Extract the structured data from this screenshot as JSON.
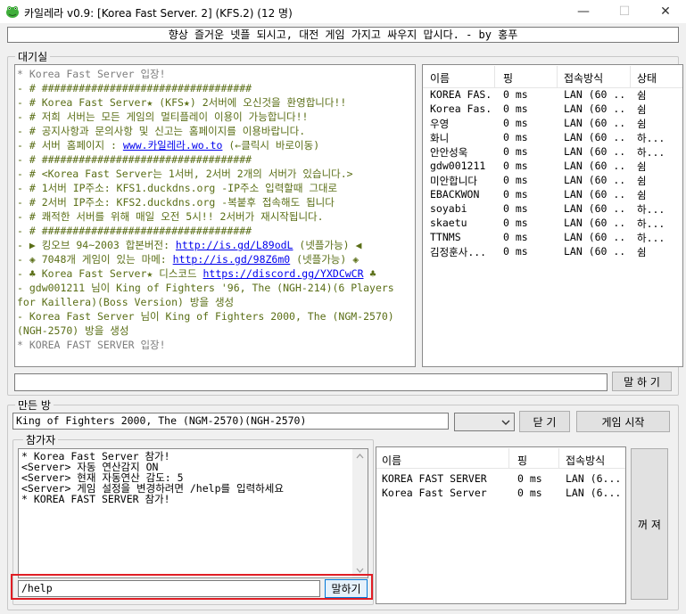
{
  "window": {
    "title": "카일레라 v0.9: [Korea Fast Server. 2] (KFS.2) (12 명)",
    "minimize_glyph": "—",
    "maximize_glyph": "☐",
    "close_glyph": "✕"
  },
  "banner": "향상 즐거운 넷플 되시고, 대전 게임 가지고 싸우지 맙시다. - by 홍푸",
  "lobby": {
    "label": "대기실",
    "chat": [
      {
        "text": "* Korea Fast Server 입장!",
        "kind": "gray"
      },
      {
        "text": "- # ##################################",
        "kind": "green"
      },
      {
        "text": "- # Korea Fast Server★ (KFS★) 2서버에 오신것을 환영합니다!!",
        "kind": "green"
      },
      {
        "text": "- # 저희 서버는 모든 게임의 멀티플레이 이용이 가능합니다!!",
        "kind": "green"
      },
      {
        "text": "- # 공지사항과 문의사항 및 신고는 홈페이지를 이용바랍니다.",
        "kind": "green"
      },
      {
        "pre": "- # 서버 홈페이지 : ",
        "link": "www.카일레라.wo.to",
        "post": " (←클릭시 바로이동)",
        "kind": "green"
      },
      {
        "text": "- # ##################################",
        "kind": "green"
      },
      {
        "text": "- # <Korea Fast Server는 1서버, 2서버 2개의 서버가 있습니다.>",
        "kind": "green"
      },
      {
        "text": "- # 1서버 IP주소: KFS1.duckdns.org -IP주소 입력할때 그대로",
        "kind": "green"
      },
      {
        "text": "- # 2서버 IP주소: KFS2.duckdns.org -복붙후 접속해도 됩니다",
        "kind": "green"
      },
      {
        "text": "- # 쾌적한 서버를 위해 매일 오전 5시!! 2서버가 재시작됩니다.",
        "kind": "green"
      },
      {
        "text": "- # ##################################",
        "kind": "green"
      },
      {
        "pre": "- ▶ 킹오브 94~2003 합본버전: ",
        "link": "http://is.gd/L89odL",
        "post": " (넷플가능) ◀",
        "kind": "green"
      },
      {
        "pre": "- ◈ 7048개 게임이 있는 마메: ",
        "link": "http://is.gd/98Z6m0",
        "post": " (넷플가능) ◈",
        "kind": "green"
      },
      {
        "pre": "- ♣ Korea Fast Server★ 디스코드 ",
        "link": "https://discord.gg/YXDCwCR",
        "post": " ♣",
        "kind": "green"
      },
      {
        "text": "- gdw001211 님이 King of Fighters '96, The (NGH-214)(6 Players for Kaillera)(Boss Version) 방을 생성",
        "kind": "green",
        "wrap": true
      },
      {
        "text": "- Korea Fast Server 님이 King of Fighters 2000, The (NGM-2570)(NGH-2570) 방을 생성",
        "kind": "green",
        "wrap": true
      },
      {
        "text": "* KOREA FAST SERVER 입장!",
        "kind": "gray"
      }
    ],
    "users_header": {
      "name": "이름",
      "ping": "핑",
      "conn": "접속방식",
      "status": "상태"
    },
    "users": [
      {
        "name": "KOREA FAS...",
        "ping": "0 ms",
        "conn": "LAN (60 ...",
        "status": "쉼"
      },
      {
        "name": "Korea Fas...",
        "ping": "0 ms",
        "conn": "LAN (60 ...",
        "status": "쉼"
      },
      {
        "name": "우영",
        "ping": "0 ms",
        "conn": "LAN (60 ...",
        "status": "쉼"
      },
      {
        "name": "화니",
        "ping": "0 ms",
        "conn": "LAN (60 ...",
        "status": "하..."
      },
      {
        "name": "안안성욱",
        "ping": "0 ms",
        "conn": "LAN (60 ...",
        "status": "하..."
      },
      {
        "name": "gdw001211",
        "ping": "0 ms",
        "conn": "LAN (60 ...",
        "status": "쉼"
      },
      {
        "name": "미안합니다",
        "ping": "0 ms",
        "conn": "LAN (60 ...",
        "status": "쉼"
      },
      {
        "name": "EBACKWON",
        "ping": "0 ms",
        "conn": "LAN (60 ...",
        "status": "쉼"
      },
      {
        "name": "soyabi",
        "ping": "0 ms",
        "conn": "LAN (60 ...",
        "status": "하..."
      },
      {
        "name": "skaetu",
        "ping": "0 ms",
        "conn": "LAN (60 ...",
        "status": "하..."
      },
      {
        "name": "TTNMS",
        "ping": "0 ms",
        "conn": "LAN (60 ...",
        "status": "하..."
      },
      {
        "name": "김정훈사...",
        "ping": "0 ms",
        "conn": "LAN (60 ...",
        "status": "쉼"
      }
    ],
    "input_value": "",
    "send_label": "말 하 기"
  },
  "room": {
    "label": "만든 방",
    "name": "King of Fighters 2000, The (NGM-2570)(NGH-2570)",
    "select_value": "",
    "close_label": "닫 기",
    "start_label": "게임 시작"
  },
  "participants": {
    "label": "참가자",
    "log": [
      "* Korea Fast Server 참가!",
      "<Server> 자동 연산감지 ON",
      "<Server> 현재 자동연산 감도: 5",
      "<Server> 게임 설정을 변경하려면 /help를 입력하세요",
      "* KOREA FAST SERVER 참가!"
    ],
    "header": {
      "name": "이름",
      "ping": "핑",
      "conn": "접속방식"
    },
    "players": [
      {
        "name": "KOREA FAST SERVER",
        "ping": "0 ms",
        "conn": "LAN (6..."
      },
      {
        "name": "Korea Fast Server",
        "ping": "0 ms",
        "conn": "LAN (6..."
      }
    ],
    "input_value": "/help",
    "send_label": "말하기",
    "leave_label": "꺼 져"
  }
}
